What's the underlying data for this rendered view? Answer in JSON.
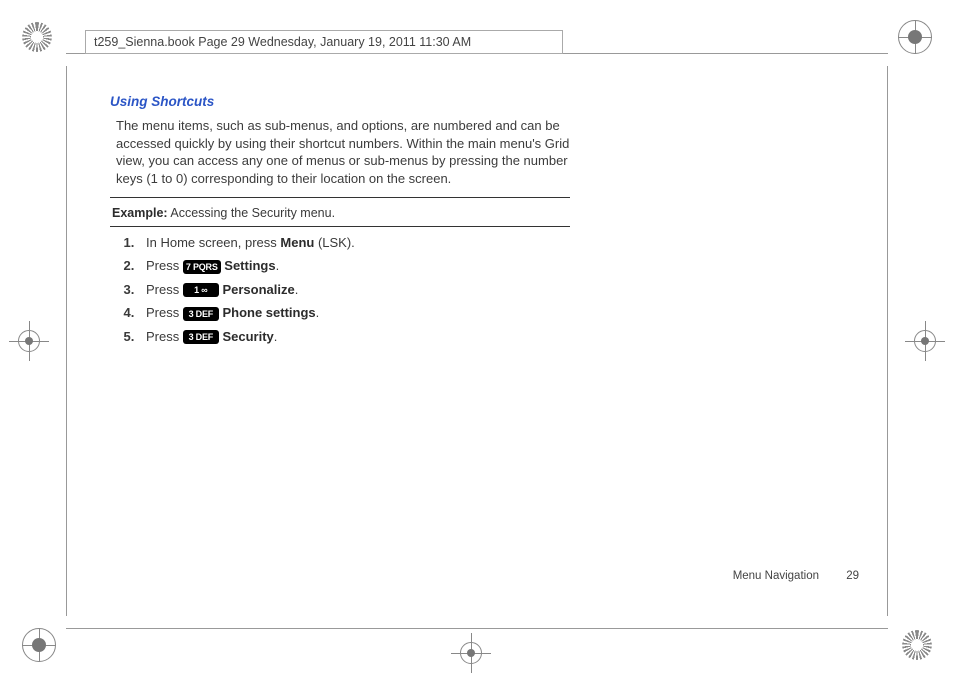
{
  "header": {
    "file_line": "t259_Sienna.book  Page 29  Wednesday, January 19, 2011  11:30 AM"
  },
  "section": {
    "heading": "Using Shortcuts",
    "intro": "The menu items, such as sub-menus, and options, are numbered and can be accessed quickly by using their shortcut numbers. Within the main menu's Grid view, you can access any one of menus or sub-menus by pressing the number keys (1 to 0) corresponding to their location on the screen."
  },
  "example": {
    "label": "Example:",
    "text": " Accessing the Security menu."
  },
  "steps": {
    "s1a": "In Home screen, press ",
    "s1b": "Menu",
    "s1c": " (LSK).",
    "s2a": "Press ",
    "key7": "7 PQRS",
    "s2b": " ",
    "s2c": "Settings",
    "s2d": ".",
    "s3a": "Press ",
    "key1": "1 ∞",
    "s3b": " ",
    "s3c": "Personalize",
    "s3d": ".",
    "s4a": "Press ",
    "key3a": "3 DEF",
    "s4b": " ",
    "s4c": "Phone settings",
    "s4d": ".",
    "s5a": "Press ",
    "key3b": "3 DEF",
    "s5b": " ",
    "s5c": "Security",
    "s5d": "."
  },
  "footer": {
    "section_name": "Menu Navigation",
    "page_number": "29"
  }
}
